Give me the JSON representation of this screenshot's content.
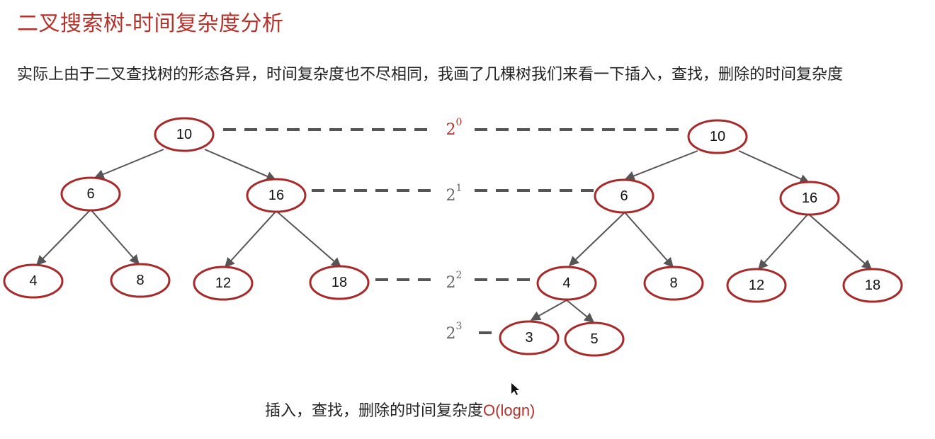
{
  "title": "二叉搜索树-时间复杂度分析",
  "paragraph": "实际上由于二叉查找树的形态各异，时间复杂度也不尽相同，我画了几棵树我们来看一下插入，查找，删除的时间复杂度",
  "footer": {
    "text": "插入，查找，删除的时间复杂度",
    "complexity": "O(logn)"
  },
  "levels": [
    {
      "base": "2",
      "exp": "0"
    },
    {
      "base": "2",
      "exp": "1"
    },
    {
      "base": "2",
      "exp": "2"
    },
    {
      "base": "2",
      "exp": "3"
    }
  ],
  "left_tree": {
    "nodes": [
      "10",
      "6",
      "16",
      "4",
      "8",
      "12",
      "18"
    ]
  },
  "right_tree": {
    "nodes": [
      "10",
      "6",
      "16",
      "4",
      "8",
      "12",
      "18",
      "3",
      "5"
    ]
  },
  "colors": {
    "accent": "#b5312b",
    "node_stroke": "#a8292a",
    "edge": "#555555"
  }
}
